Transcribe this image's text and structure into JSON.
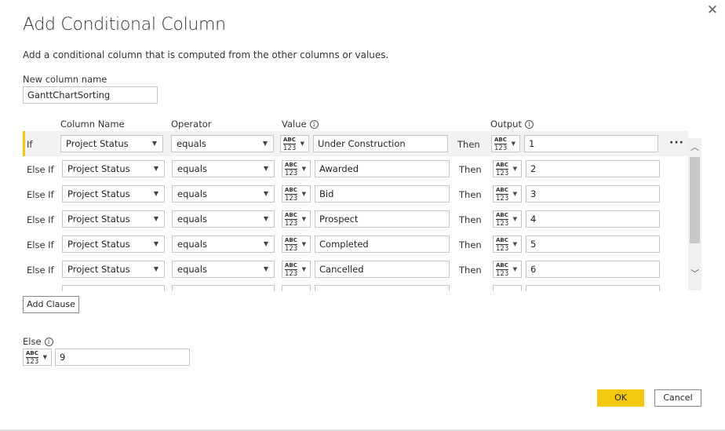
{
  "dialog": {
    "close_icon": "close-icon",
    "title": "Add Conditional Column",
    "description": "Add a conditional column that is computed from the other columns or values.",
    "new_column_label": "New column name",
    "new_column_value": "GanttChartSorting"
  },
  "headers": {
    "column_name": "Column Name",
    "operator": "Operator",
    "value": "Value",
    "output": "Output"
  },
  "type_icon": {
    "top": "ABC",
    "bottom": "123"
  },
  "rows": [
    {
      "keyword": "If",
      "column": "Project Status",
      "operator": "equals",
      "value": "Under Construction",
      "then": "Then",
      "output": "1"
    },
    {
      "keyword": "Else If",
      "column": "Project Status",
      "operator": "equals",
      "value": "Awarded",
      "then": "Then",
      "output": "2"
    },
    {
      "keyword": "Else If",
      "column": "Project Status",
      "operator": "equals",
      "value": "Bid",
      "then": "Then",
      "output": "3"
    },
    {
      "keyword": "Else If",
      "column": "Project Status",
      "operator": "equals",
      "value": "Prospect",
      "then": "Then",
      "output": "4"
    },
    {
      "keyword": "Else If",
      "column": "Project Status",
      "operator": "equals",
      "value": "Completed",
      "then": "Then",
      "output": "5"
    },
    {
      "keyword": "Else If",
      "column": "Project Status",
      "operator": "equals",
      "value": "Cancelled",
      "then": "Then",
      "output": "6"
    }
  ],
  "more_options": "···",
  "add_clause_label": "Add Clause",
  "else_label": "Else",
  "else_value": "9",
  "ok_label": "OK",
  "cancel_label": "Cancel",
  "colors": {
    "accent": "#f2c811",
    "row_highlight": "#f3f2f1",
    "border": "#c8c6c4"
  }
}
